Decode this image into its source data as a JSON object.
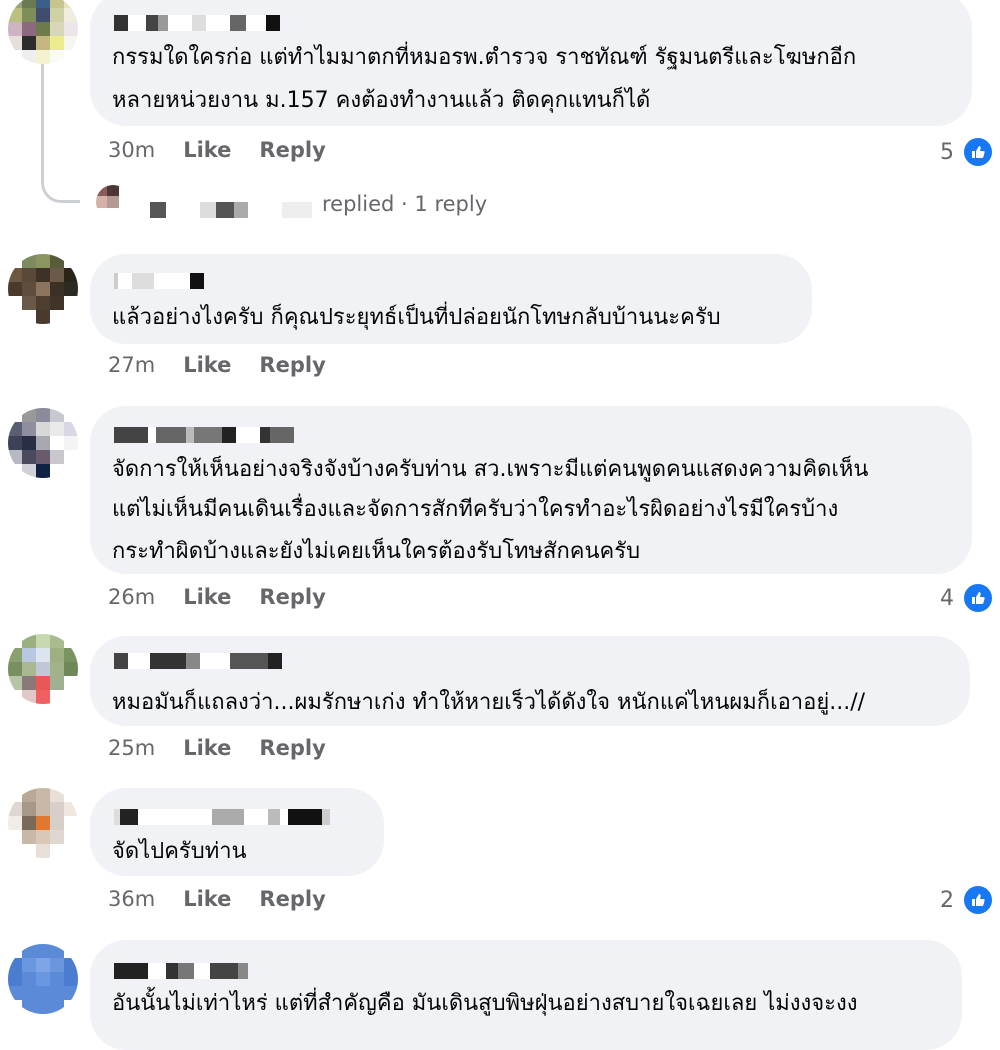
{
  "comments": [
    {
      "text_lines": [
        "กรรมใดใครก่อ  แต่ทำไมมาตกที่หมอรพ.ตำรวจ  ราชทัณฑ์  รัฐมนตรีและโฆษกอีก",
        "หลายหน่วยงาน ม.157  คงต้องทำงานแล้ว  ติดคุกแทนก็ได้"
      ],
      "time": "30m",
      "like": "Like",
      "reply": "Reply",
      "reactions": "5"
    },
    {
      "text_lines": [
        "แล้วอย่างไงครับ ก็คุณประยุทธ์เป็นที่ปล่อยนักโทษกลับบ้านนะครับ"
      ],
      "time": "27m",
      "like": "Like",
      "reply": "Reply",
      "reactions": ""
    },
    {
      "text_lines": [
        "จัดการให้เห็นอย่างจริงจังบ้างครับท่าน สว.เพราะมีแต่คนพูดคนแสดงความคิดเห็น",
        "แต่ไม่เห็นมีคนเดินเรื่องและจัดการสักทีครับว่าใครทำอะไรผิดอย่างไรมีใครบ้าง",
        "กระทำผิดบ้างและยังไม่เคยเห็นใครต้องรับโทษสักคนครับ"
      ],
      "time": "26m",
      "like": "Like",
      "reply": "Reply",
      "reactions": "4"
    },
    {
      "text_lines": [
        "หมอมันก็แถลงว่า...ผมรักษาเก่ง ทำให้หายเร็วได้ดังใจ หนักแค่ไหนผมก็เอาอยู่...//"
      ],
      "time": "25m",
      "like": "Like",
      "reply": "Reply",
      "reactions": ""
    },
    {
      "text_lines": [
        "จัดไปครับท่าน"
      ],
      "time": "36m",
      "like": "Like",
      "reply": "Reply",
      "reactions": "2"
    },
    {
      "text_lines": [
        "อันนั้นไม่เท่าไหร่ แต่ที่สำคัญคือ มันเดินสูบพิษฝุ่นอย่างสบายใจเฉยเลย ไม่งงจะงง"
      ],
      "time": "",
      "like": "",
      "reply": "",
      "reactions": ""
    }
  ],
  "reply_thread": {
    "label": "replied",
    "count": "1 reply",
    "separator": "·"
  },
  "icons": {
    "reaction": "like-thumb-icon"
  },
  "colors": {
    "bubble": "#f0f2f5",
    "meta": "#65676b",
    "like_blue": "#1877f2"
  }
}
